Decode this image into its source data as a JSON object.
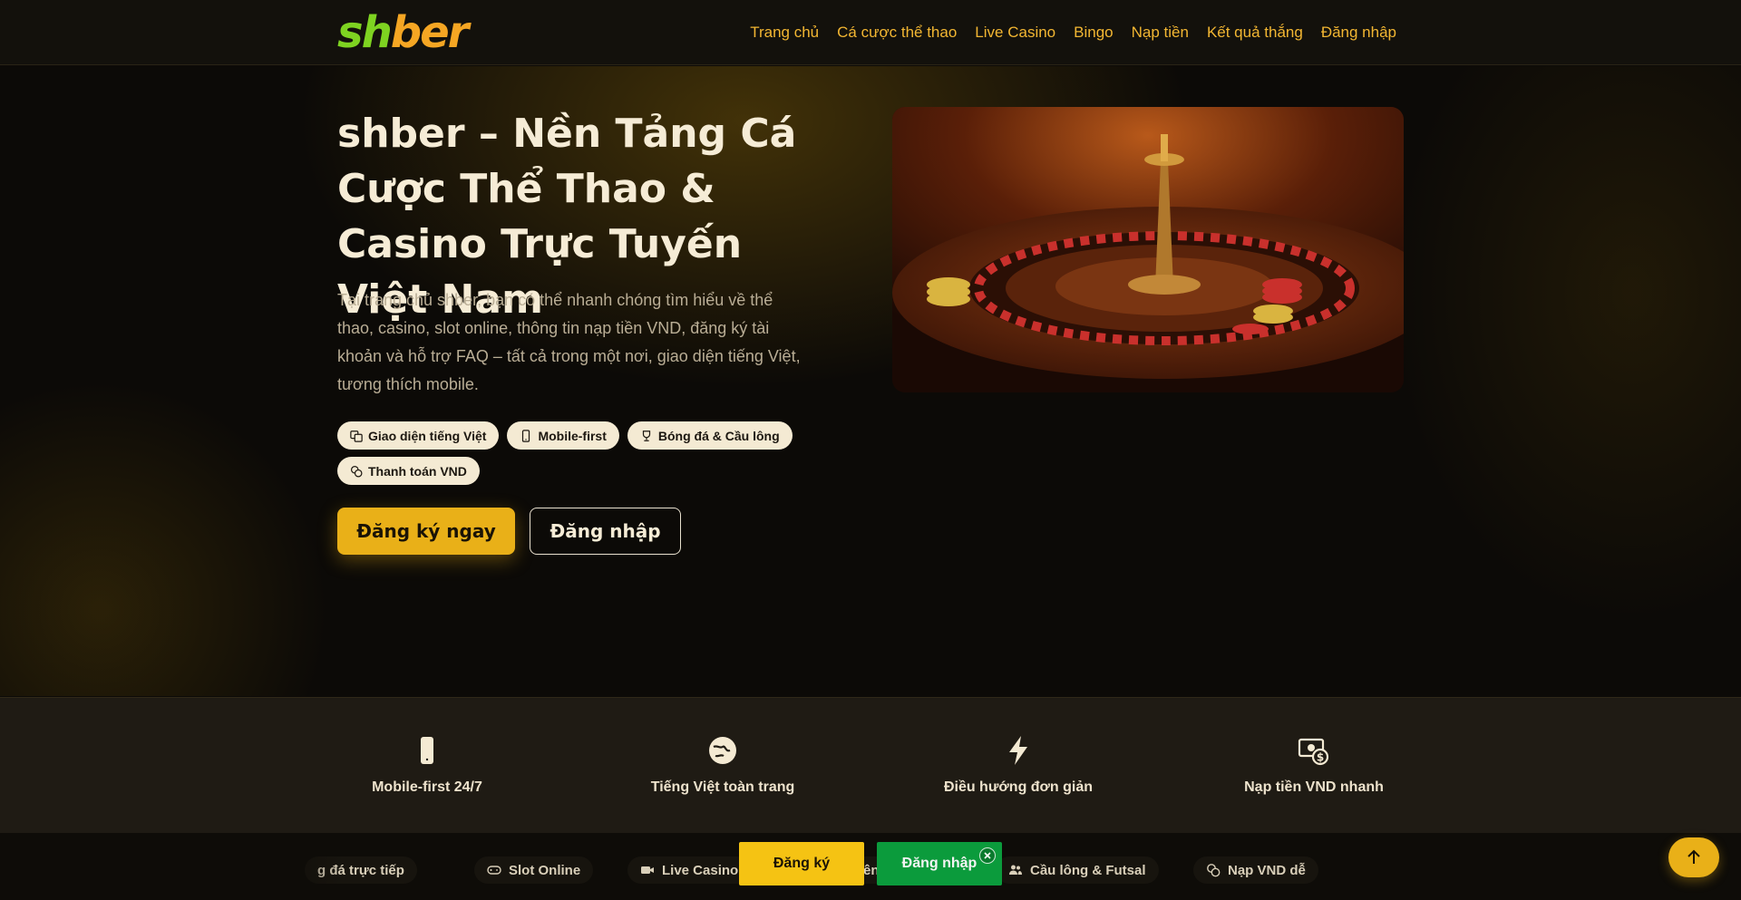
{
  "header": {
    "logo": {
      "part1": "sh",
      "part2": "ber"
    },
    "nav": [
      "Trang chủ",
      "Cá cược thể thao",
      "Live Casino",
      "Bingo",
      "Nạp tiền",
      "Kết quả thắng",
      "Đăng nhập"
    ]
  },
  "hero": {
    "title": "shber – Nền Tảng Cá Cược Thể Thao & Casino Trực Tuyến Việt Nam",
    "description": "Tại trang chủ shber, bạn có thể nhanh chóng tìm hiểu về thể thao, casino, slot online, thông tin nạp tiền VND, đăng ký tài khoản và hỗ trợ FAQ – tất cả trong một nơi, giao diện tiếng Việt, tương thích mobile.",
    "tags": [
      {
        "label": "Giao diện tiếng Việt",
        "icon": "translate-icon"
      },
      {
        "label": "Mobile-first",
        "icon": "phone-icon"
      },
      {
        "label": "Bóng đá & Cầu lông",
        "icon": "trophy-icon"
      },
      {
        "label": "Thanh toán VND",
        "icon": "coins-icon"
      }
    ],
    "primary_button": "Đăng ký ngay",
    "secondary_button": "Đăng nhập",
    "image_alt": "roulette-wheel-image"
  },
  "features": [
    {
      "label": "Mobile-first 24/7",
      "icon": "phone-icon"
    },
    {
      "label": "Tiếng Việt toàn trang",
      "icon": "globe-icon"
    },
    {
      "label": "Điều hướng đơn giản",
      "icon": "lightning-icon"
    },
    {
      "label": "Nạp tiền VND nhanh",
      "icon": "money-icon"
    }
  ],
  "ticker": {
    "items": [
      {
        "label": "g đá trực tiếp",
        "icon": ""
      },
      {
        "label": "Slot Online",
        "icon": "gamepad-icon"
      },
      {
        "label": "Live Casino",
        "icon": "video-icon"
      },
      {
        "label": "ên",
        "icon": ""
      },
      {
        "label": "Cầu lông & Futsal",
        "icon": "users-icon"
      },
      {
        "label": "Nạp VND dễ",
        "icon": "coins-icon"
      }
    ]
  },
  "sticky": {
    "register": "Đăng ký",
    "login": "Đăng nhập"
  },
  "colors": {
    "accent": "#e9b018",
    "nav": "#f2b632",
    "login_green": "#0b9b3c",
    "logo_green": "#7ed321",
    "logo_orange": "#f5a623"
  }
}
